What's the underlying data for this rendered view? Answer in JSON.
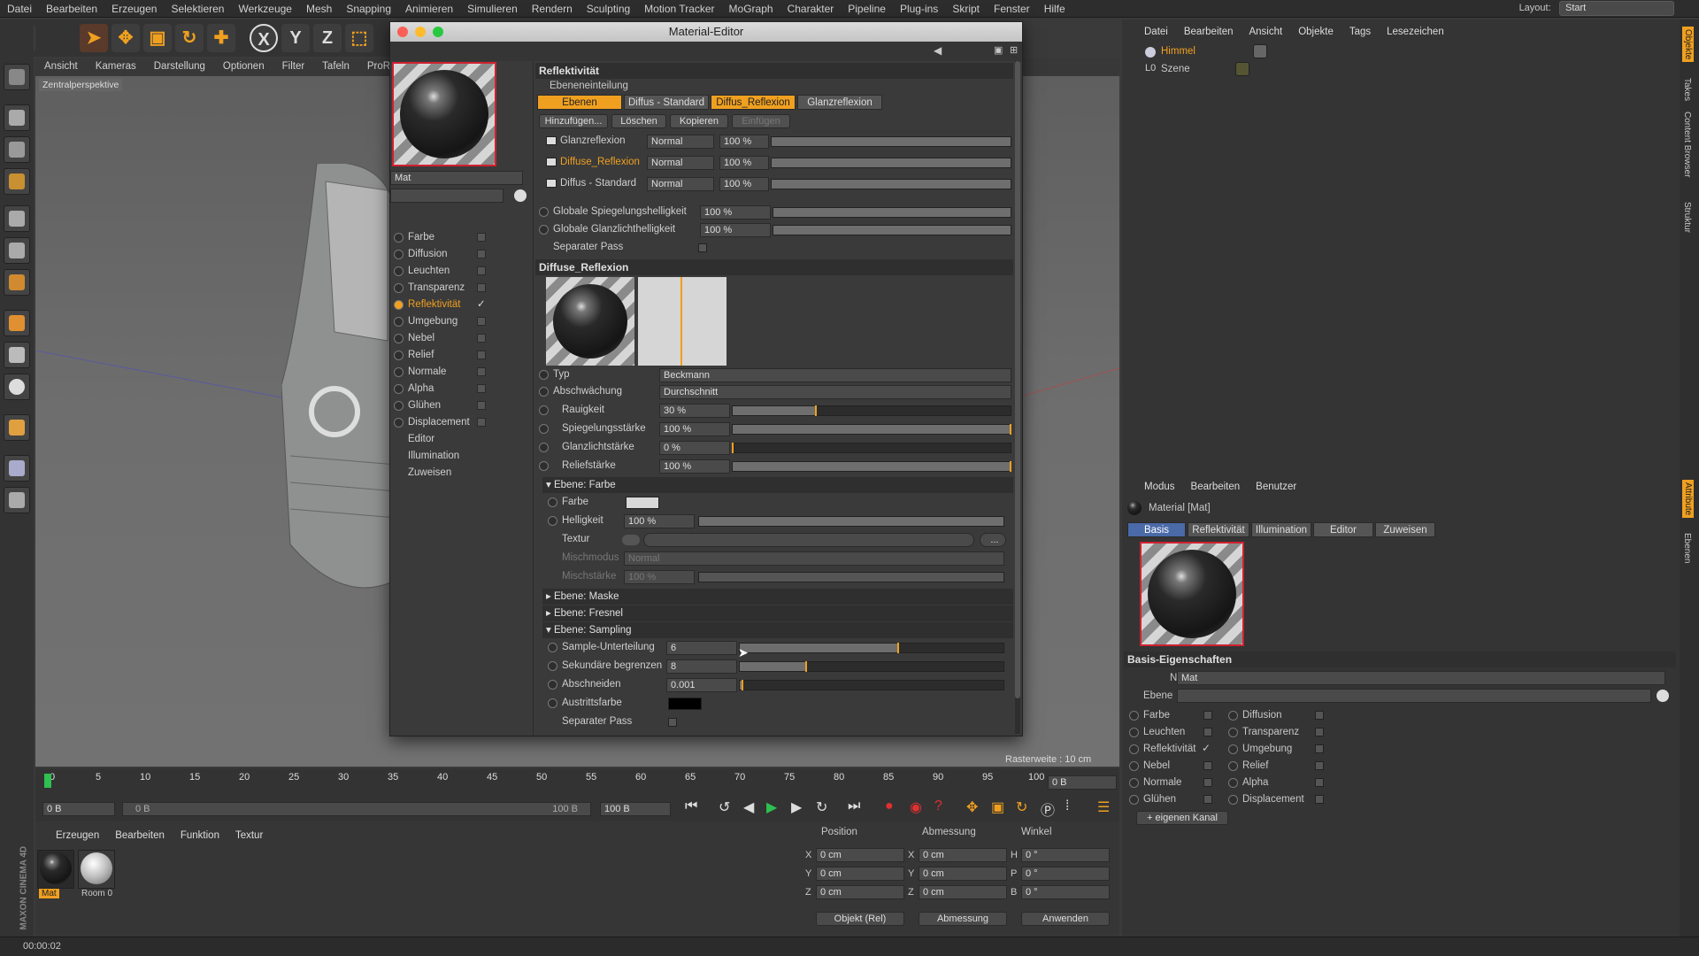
{
  "menubar": {
    "items": [
      "Datei",
      "Bearbeiten",
      "Erzeugen",
      "Selektieren",
      "Werkzeuge",
      "Mesh",
      "Snapping",
      "Animieren",
      "Simulieren",
      "Rendern",
      "Sculpting",
      "Motion Tracker",
      "MoGraph",
      "Charakter",
      "Pipeline",
      "Plug-ins",
      "Skript",
      "Fenster",
      "Hilfe"
    ],
    "layout_label": "Layout:",
    "layout_value": "Start"
  },
  "viewport": {
    "menu": [
      "Ansicht",
      "Kameras",
      "Darstellung",
      "Optionen",
      "Filter",
      "Tafeln",
      "ProRen"
    ],
    "label": "Zentralperspektive",
    "grid_info": "Rasterweite : 10 cm"
  },
  "top_tools": {
    "axis_x": "X",
    "axis_y": "Y",
    "axis_z": "Z"
  },
  "timeline": {
    "ticks": [
      "0",
      "5",
      "10",
      "15",
      "20",
      "25",
      "30",
      "35",
      "40",
      "45",
      "50",
      "55",
      "60",
      "65",
      "70",
      "75",
      "80",
      "85",
      "90",
      "95",
      "100"
    ],
    "frame_right": "0 B",
    "start": "0 B",
    "range_start": "0 B",
    "range_end": "100 B",
    "end": "100 B"
  },
  "material_manager": {
    "menu": [
      "Erzeugen",
      "Bearbeiten",
      "Funktion",
      "Textur"
    ],
    "materials": [
      {
        "name": "Mat"
      },
      {
        "name": "Room 0"
      }
    ],
    "brand": "MAXON CINEMA 4D"
  },
  "coords": {
    "headers": [
      "Position",
      "Abmessung",
      "Winkel"
    ],
    "rows": [
      {
        "axis": "X",
        "pos": "0 cm",
        "size_axis": "X",
        "size": "0 cm",
        "ang_axis": "H",
        "ang": "0 °"
      },
      {
        "axis": "Y",
        "pos": "0 cm",
        "size_axis": "Y",
        "size": "0 cm",
        "ang_axis": "P",
        "ang": "0 °"
      },
      {
        "axis": "Z",
        "pos": "0 cm",
        "size_axis": "Z",
        "size": "0 cm",
        "ang_axis": "B",
        "ang": "0 °"
      }
    ],
    "mode1": "Objekt (Rel)",
    "mode2": "Abmessung",
    "apply": "Anwenden"
  },
  "status": {
    "time": "00:00:02"
  },
  "objects_panel": {
    "menu": [
      "Datei",
      "Bearbeiten",
      "Ansicht",
      "Objekte",
      "Tags",
      "Lesezeichen"
    ],
    "items": [
      {
        "name": "Himmel"
      },
      {
        "name": "Szene"
      }
    ]
  },
  "side_tabs": [
    "Objekte",
    "Takes",
    "Content Browser",
    "Struktur",
    "Attribute",
    "Ebenen"
  ],
  "attributes": {
    "menu": [
      "Modus",
      "Bearbeiten",
      "Benutzer"
    ],
    "title": "Material [Mat]",
    "tabs": [
      "Basis",
      "Reflektivität",
      "Illumination",
      "Editor",
      "Zuweisen"
    ],
    "section": "Basis-Eigenschaften",
    "name_label": "Name",
    "name_value": "Mat",
    "layer_label": "Ebene",
    "channels_left": [
      "Farbe",
      "Leuchten",
      "Reflektivität",
      "Nebel",
      "Normale",
      "Glühen"
    ],
    "channels_right": [
      "Diffusion",
      "Transparenz",
      "Umgebung",
      "Relief",
      "Alpha",
      "Displacement"
    ],
    "add_channel": "+ eigenen Kanal"
  },
  "editor": {
    "title": "Material-Editor",
    "mat_name": "Mat",
    "channels": [
      {
        "label": "Farbe",
        "checked": false
      },
      {
        "label": "Diffusion",
        "checked": false
      },
      {
        "label": "Leuchten",
        "checked": false
      },
      {
        "label": "Transparenz",
        "checked": false
      },
      {
        "label": "Reflektivität",
        "checked": true
      },
      {
        "label": "Umgebung",
        "checked": false
      },
      {
        "label": "Nebel",
        "checked": false
      },
      {
        "label": "Relief",
        "checked": false
      },
      {
        "label": "Normale",
        "checked": false
      },
      {
        "label": "Alpha",
        "checked": false
      },
      {
        "label": "Glühen",
        "checked": false
      },
      {
        "label": "Displacement",
        "checked": false
      }
    ],
    "extra": [
      "Editor",
      "Illumination",
      "Zuweisen"
    ],
    "section_title": "Reflektivität",
    "layer_mgmt": "Ebeneneinteilung",
    "tabs": [
      "Ebenen",
      "Diffus - Standard",
      "Diffus_Reflexion",
      "Glanzreflexion"
    ],
    "buttons": [
      "Hinzufügen...",
      "Löschen",
      "Kopieren",
      "Einfügen"
    ],
    "layers": [
      {
        "name": "Glanzreflexion",
        "mode": "Normal",
        "value": "100 %"
      },
      {
        "name": "Diffuse_Reflexion",
        "mode": "Normal",
        "value": "100 %"
      },
      {
        "name": "Diffus - Standard",
        "mode": "Normal",
        "value": "100 %"
      }
    ],
    "global": [
      {
        "label": "Globale Spiegelungshelligkeit",
        "value": "100 %"
      },
      {
        "label": "Globale Glanzlichthelligkeit",
        "value": "100 %"
      }
    ],
    "separate_pass": "Separater Pass",
    "layer_title": "Diffuse_Reflexion",
    "typ_label": "Typ",
    "typ_value": "Beckmann",
    "abs_label": "Abschwächung",
    "abs_value": "Durchschnitt",
    "params": [
      {
        "label": "Rauigkeit",
        "value": "30 %",
        "level": 0.3
      },
      {
        "label": "Spiegelungsstärke",
        "value": "100 %",
        "level": 1.0
      },
      {
        "label": "Glanzlichtstärke",
        "value": "0 %",
        "level": 0.0
      },
      {
        "label": "Reliefstärke",
        "value": "100 %",
        "level": 1.0
      }
    ],
    "color_group": "Ebene: Farbe",
    "color_label": "Farbe",
    "bright_label": "Helligkeit",
    "bright_value": "100 %",
    "texture_label": "Textur",
    "texture_more": "...",
    "mix_label": "Mischmodus",
    "mix_value": "Normal",
    "mixs_label": "Mischstärke",
    "mixs_value": "100 %",
    "mask_group": "Ebene: Maske",
    "fresnel_group": "Ebene: Fresnel",
    "sampling_group": "Ebene: Sampling",
    "sampling": [
      {
        "label": "Sample-Unterteilung",
        "value": "6",
        "level": 0.6
      },
      {
        "label": "Sekundäre begrenzen",
        "value": "8",
        "level": 0.25
      },
      {
        "label": "Abschneiden",
        "value": "0.001",
        "level": 0.01
      }
    ],
    "exit_color_label": "Austrittsfarbe",
    "sep_pass2": "Separater Pass"
  },
  "colors": {
    "accent": "#f0a020",
    "panel": "#3a3a3a"
  }
}
